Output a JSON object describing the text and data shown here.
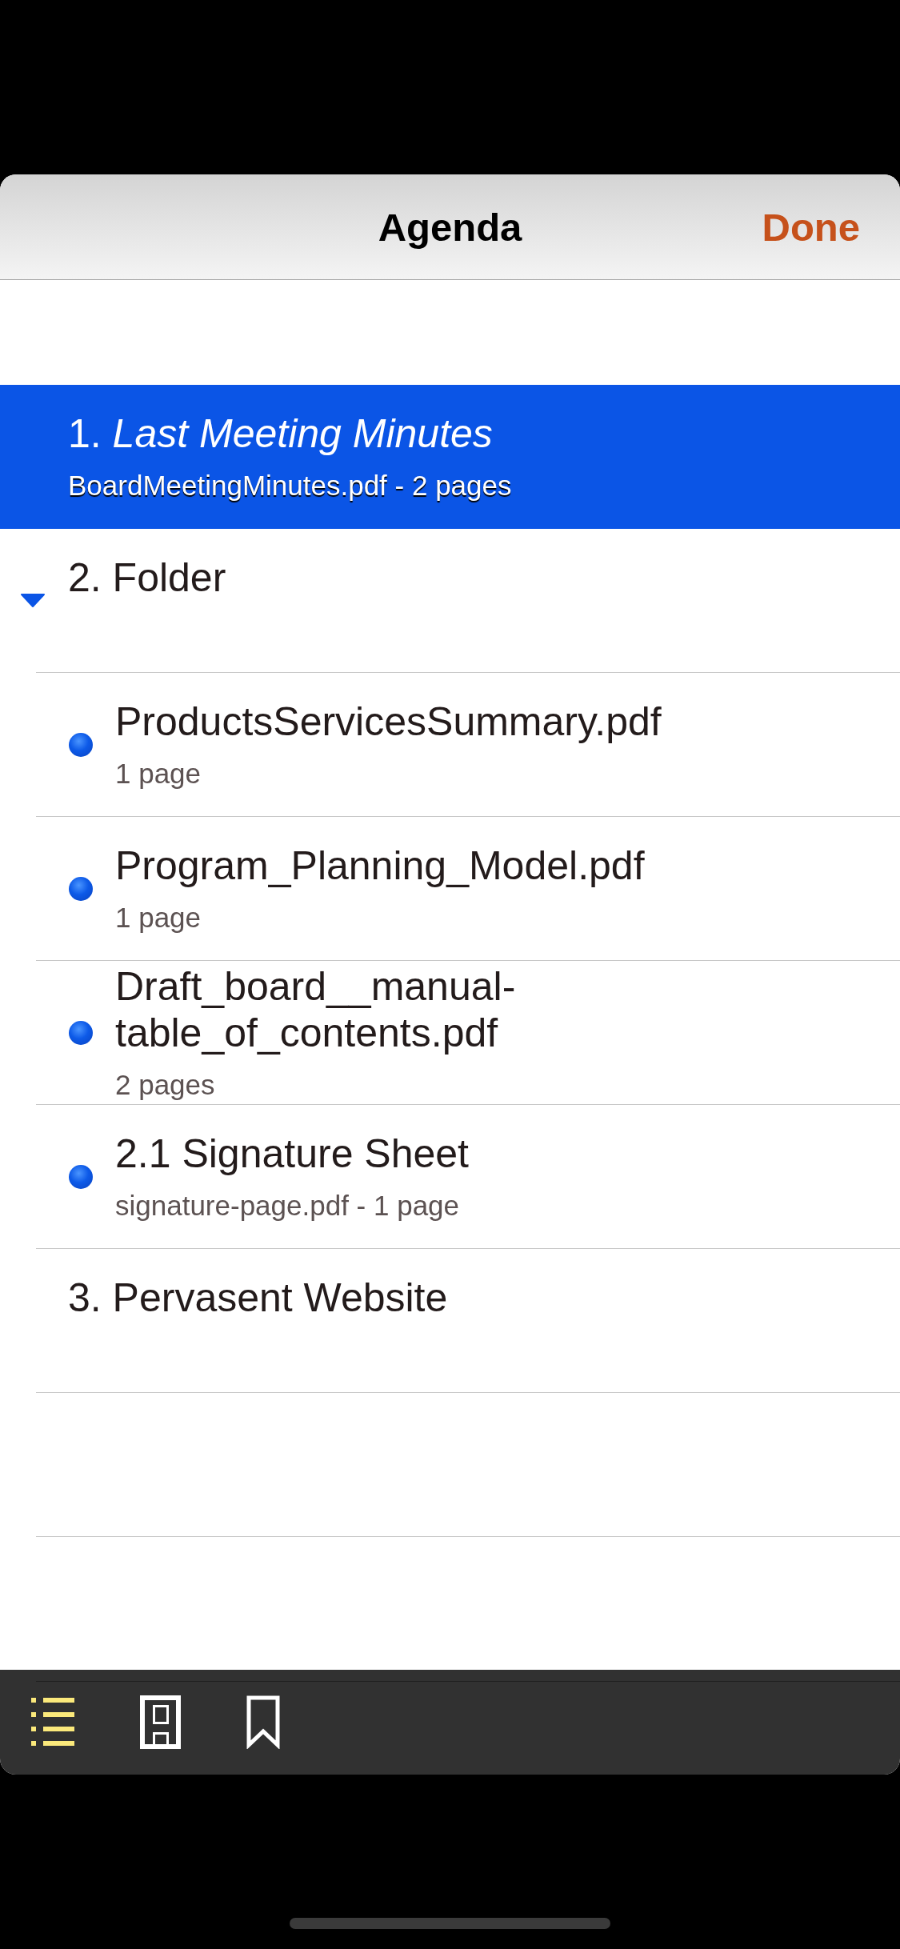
{
  "header": {
    "title": "Agenda",
    "done_button": "Done"
  },
  "agenda": [
    {
      "kind": "document",
      "title": "1. *Last Meeting Minutes*",
      "subtitle": "BoardMeetingMinutes.pdf - 2 pages",
      "selected": true
    },
    {
      "kind": "folder",
      "title": "2. Folder",
      "expanded": true,
      "selected": false,
      "children": [
        {
          "title": "ProductsServicesSummary.pdf",
          "subtitle": "1 page",
          "selected": false
        },
        {
          "title": "Program_Planning_Model.pdf",
          "subtitle": "1 page",
          "selected": false
        },
        {
          "title": "Draft_board__manual-table_of_contents.pdf",
          "subtitle": "2 pages",
          "selected": false
        },
        {
          "title": "2.1 Signature Sheet",
          "subtitle": "signature-page.pdf - 1 page",
          "selected": false
        }
      ]
    },
    {
      "kind": "document",
      "title": "3. Pervasent Website",
      "selected": false
    }
  ],
  "toolbar": [
    {
      "kind": "outline",
      "selected": true
    },
    {
      "kind": "pages",
      "selected": false
    },
    {
      "kind": "bookmarks",
      "selected": false
    }
  ]
}
